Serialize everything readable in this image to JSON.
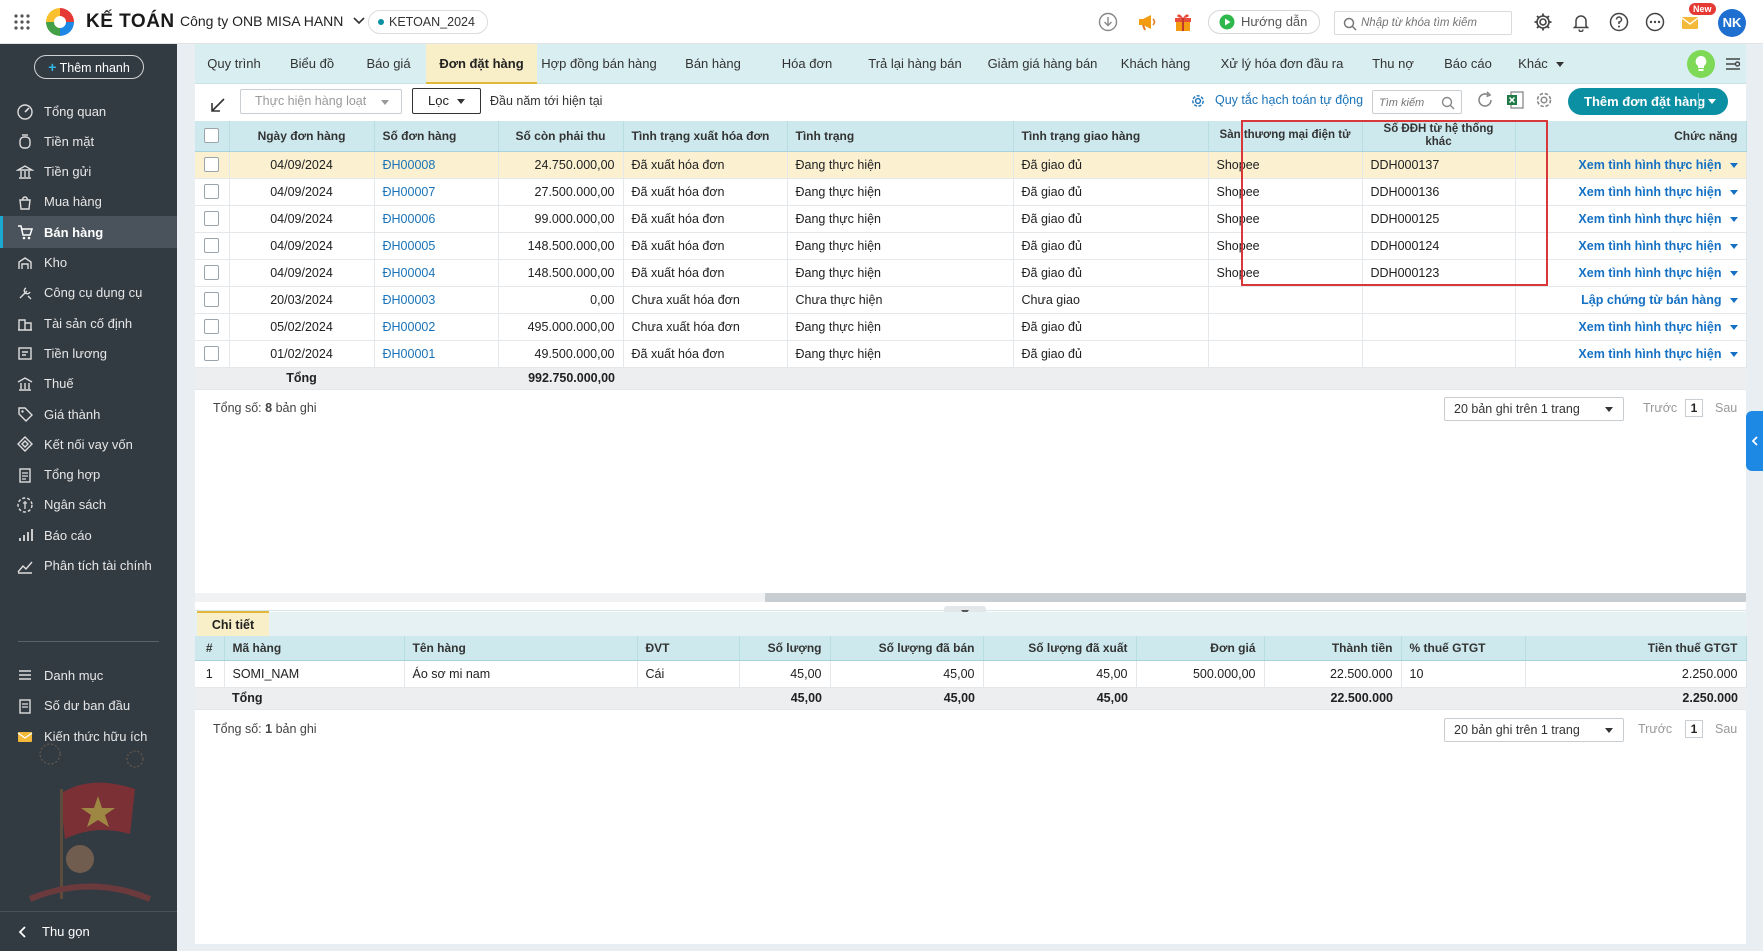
{
  "app": {
    "brand": "KẾ TOÁN",
    "company": "Công ty ONB MISA HANN",
    "database": "KETOAN_2024",
    "guide_label": "Hướng dẫn",
    "search_placeholder": "Nhập từ khóa tìm kiếm",
    "new_badge": "New",
    "user_initials": "NK"
  },
  "sidebar": {
    "quick_add": "Thêm nhanh",
    "items": [
      {
        "label": "Tổng quan",
        "icon": "dashboard-icon"
      },
      {
        "label": "Tiền mặt",
        "icon": "cash-icon"
      },
      {
        "label": "Tiền gửi",
        "icon": "bank-icon"
      },
      {
        "label": "Mua hàng",
        "icon": "purchase-icon"
      },
      {
        "label": "Bán hàng",
        "icon": "cart-icon"
      },
      {
        "label": "Kho",
        "icon": "warehouse-icon"
      },
      {
        "label": "Công cụ dụng cụ",
        "icon": "tools-icon"
      },
      {
        "label": "Tài sản cố định",
        "icon": "asset-icon"
      },
      {
        "label": "Tiền lương",
        "icon": "salary-icon"
      },
      {
        "label": "Thuế",
        "icon": "tax-icon"
      },
      {
        "label": "Giá thành",
        "icon": "price-tag-icon"
      },
      {
        "label": "Kết nối vay vốn",
        "icon": "loan-icon"
      },
      {
        "label": "Tổng hợp",
        "icon": "summary-icon"
      },
      {
        "label": "Ngân sách",
        "icon": "budget-icon"
      },
      {
        "label": "Báo cáo",
        "icon": "report-icon"
      },
      {
        "label": "Phân tích tài chính",
        "icon": "analytics-icon"
      }
    ],
    "items2": [
      {
        "label": "Danh mục",
        "icon": "list-icon"
      },
      {
        "label": "Số dư ban đầu",
        "icon": "balance-icon"
      },
      {
        "label": "Kiến thức hữu ích",
        "icon": "knowledge-icon"
      }
    ],
    "collapse": "Thu gọn"
  },
  "tabs": [
    "Quy trình",
    "Biểu đồ",
    "Báo giá",
    "Đơn đặt hàng",
    "Hợp đồng bán hàng",
    "Bán hàng",
    "Hóa đơn",
    "Trả lại hàng bán",
    "Giảm giá hàng bán",
    "Khách hàng",
    "Xử lý hóa đơn đầu ra",
    "Thu nợ",
    "Báo cáo",
    "Khác"
  ],
  "toolbar": {
    "bulk_action": "Thực hiện hàng loạt",
    "filter": "Lọc",
    "period": "Đầu năm tới hiện tại",
    "auto_rule": "Quy tắc hạch toán tự động",
    "search_placeholder": "Tìm kiếm",
    "add_order": "Thêm đơn đặt hàng"
  },
  "orders": {
    "columns": [
      "Ngày đơn hàng",
      "Số đơn hàng",
      "Số còn phải thu",
      "Tình trạng xuất hóa đơn",
      "Tình trạng",
      "Tình trạng giao hàng",
      "Sàn thương mại điện tử",
      "Số ĐĐH từ hệ thống khác",
      "Chức năng"
    ],
    "rows": [
      {
        "date": "04/09/2024",
        "no": "ĐH00008",
        "amount": "24.750.000,00",
        "invoice": "Đã xuất hóa đơn",
        "status": "Đang thực hiện",
        "delivery": "Đã giao đủ",
        "platform": "Shopee",
        "ext": "DDH000137",
        "action": "Xem tình hình thực hiện"
      },
      {
        "date": "04/09/2024",
        "no": "ĐH00007",
        "amount": "27.500.000,00",
        "invoice": "Đã xuất hóa đơn",
        "status": "Đang thực hiện",
        "delivery": "Đã giao đủ",
        "platform": "Shopee",
        "ext": "DDH000136",
        "action": "Xem tình hình thực hiện"
      },
      {
        "date": "04/09/2024",
        "no": "ĐH00006",
        "amount": "99.000.000,00",
        "invoice": "Đã xuất hóa đơn",
        "status": "Đang thực hiện",
        "delivery": "Đã giao đủ",
        "platform": "Shopee",
        "ext": "DDH000125",
        "action": "Xem tình hình thực hiện"
      },
      {
        "date": "04/09/2024",
        "no": "ĐH00005",
        "amount": "148.500.000,00",
        "invoice": "Đã xuất hóa đơn",
        "status": "Đang thực hiện",
        "delivery": "Đã giao đủ",
        "platform": "Shopee",
        "ext": "DDH000124",
        "action": "Xem tình hình thực hiện"
      },
      {
        "date": "04/09/2024",
        "no": "ĐH00004",
        "amount": "148.500.000,00",
        "invoice": "Đã xuất hóa đơn",
        "status": "Đang thực hiện",
        "delivery": "Đã giao đủ",
        "platform": "Shopee",
        "ext": "DDH000123",
        "action": "Xem tình hình thực hiện"
      },
      {
        "date": "20/03/2024",
        "no": "ĐH00003",
        "amount": "0,00",
        "invoice": "Chưa xuất hóa đơn",
        "status": "Chưa thực hiện",
        "delivery": "Chưa giao",
        "platform": "",
        "ext": "",
        "action": "Lập chứng từ bán hàng"
      },
      {
        "date": "05/02/2024",
        "no": "ĐH00002",
        "amount": "495.000.000,00",
        "invoice": "Chưa xuất hóa đơn",
        "status": "Đang thực hiện",
        "delivery": "Đã giao đủ",
        "platform": "",
        "ext": "",
        "action": "Xem tình hình thực hiện"
      },
      {
        "date": "01/02/2024",
        "no": "ĐH00001",
        "amount": "49.500.000,00",
        "invoice": "Đã xuất hóa đơn",
        "status": "Đang thực hiện",
        "delivery": "Đã giao đủ",
        "platform": "",
        "ext": "",
        "action": "Xem tình hình thực hiện"
      }
    ],
    "total_label": "Tổng",
    "total_amount": "992.750.000,00",
    "count_prefix": "Tổng số:",
    "count": "8",
    "count_suffix": "bản ghi",
    "page_size": "20 bản ghi trên 1 trang",
    "prev": "Trước",
    "page": "1",
    "next": "Sau"
  },
  "detail": {
    "tab": "Chi tiết",
    "columns": [
      "#",
      "Mã hàng",
      "Tên hàng",
      "ĐVT",
      "Số lượng",
      "Số lượng đã bán",
      "Số lượng đã xuất",
      "Đơn giá",
      "Thành tiền",
      "% thuế GTGT",
      "Tiền thuế GTGT"
    ],
    "rows": [
      {
        "idx": "1",
        "code": "SOMI_NAM",
        "name": "Áo sơ mi nam",
        "unit": "Cái",
        "qty": "45,00",
        "sold": "45,00",
        "exported": "45,00",
        "price": "500.000,00",
        "total": "22.500.000",
        "vat_pct": "10",
        "vat": "2.250.000"
      }
    ],
    "totals": {
      "label": "Tổng",
      "qty": "45,00",
      "sold": "45,00",
      "exported": "45,00",
      "total": "22.500.000",
      "vat": "2.250.000"
    },
    "count_prefix": "Tổng số:",
    "count": "1",
    "count_suffix": "bản ghi",
    "page_size": "20 bản ghi trên 1 trang",
    "prev": "Trước",
    "page": "1",
    "next": "Sau"
  },
  "colors": {
    "accent": "#0b8fa3",
    "highlight": "#d9383a",
    "selected_row": "#fbf1d1",
    "sidebar": "#333b42"
  }
}
